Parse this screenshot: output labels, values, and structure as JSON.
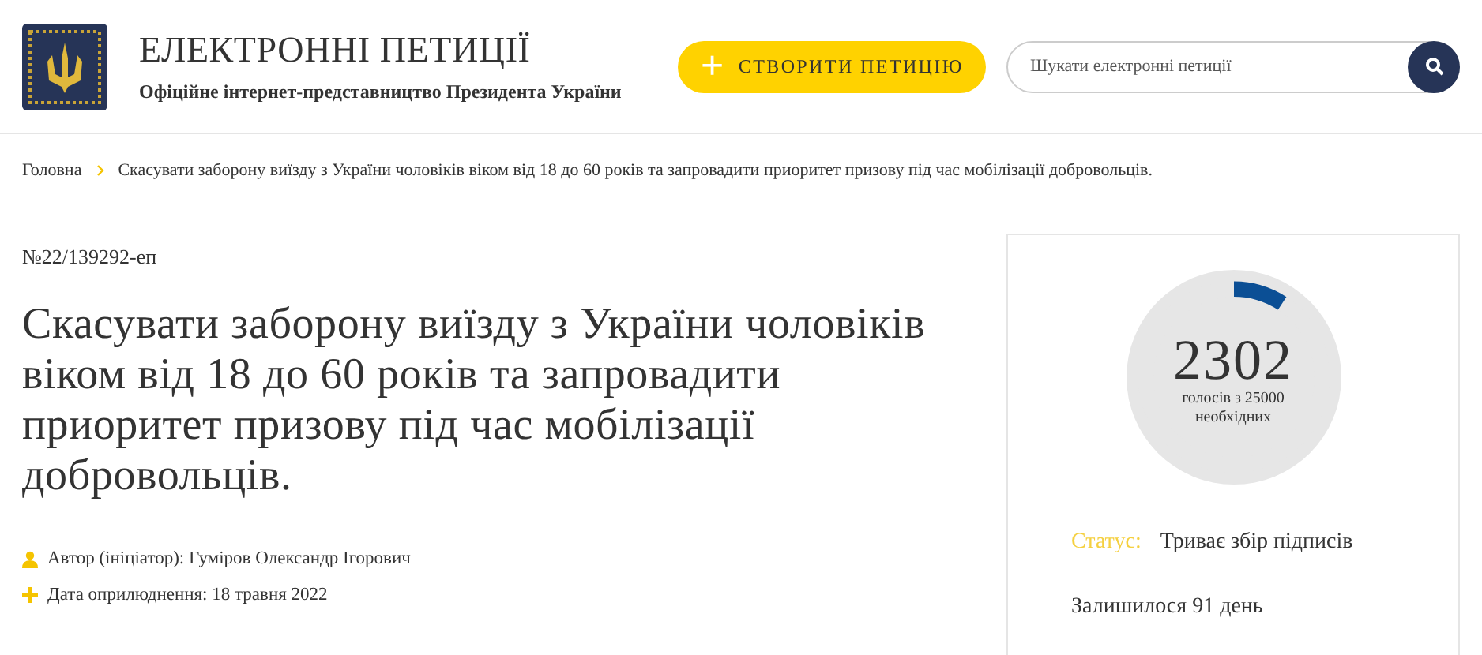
{
  "header": {
    "title": "ЕЛЕКТРОННІ ПЕТИЦІЇ",
    "subtitle": "Офіційне інтернет-представництво Президента України",
    "create_button": {
      "icon": "+",
      "label": "СТВОРИТИ ПЕТИЦІЮ"
    },
    "search": {
      "placeholder": "Шукати електронні петиції"
    }
  },
  "breadcrumb": [
    {
      "label": "Головна"
    },
    {
      "label": "Скасувати заборону виїзду з України чоловіків віком від 18 до 60 років та запровадити приоритет призову під час мобілізації добровольців."
    }
  ],
  "petition": {
    "number": "№22/139292-еп",
    "title": "Скасувати заборону виїзду з України чоловіків віком від 18 до 60 років та запровадити приоритет призову під час мобілізації добровольців.",
    "meta": [
      {
        "kind": "author",
        "text": "Автор (ініціатор): Гуміров Олександр Ігорович"
      },
      {
        "kind": "date",
        "text": "Дата оприлюднення: 18 травня 2022"
      }
    ]
  },
  "votes": {
    "count": "2302",
    "caption": "голосів з 25000 необхідних",
    "level": 0.092,
    "status_label": "Статус:",
    "status": "Триває збір підписів",
    "remaining": "Залишилося 91 день"
  }
}
